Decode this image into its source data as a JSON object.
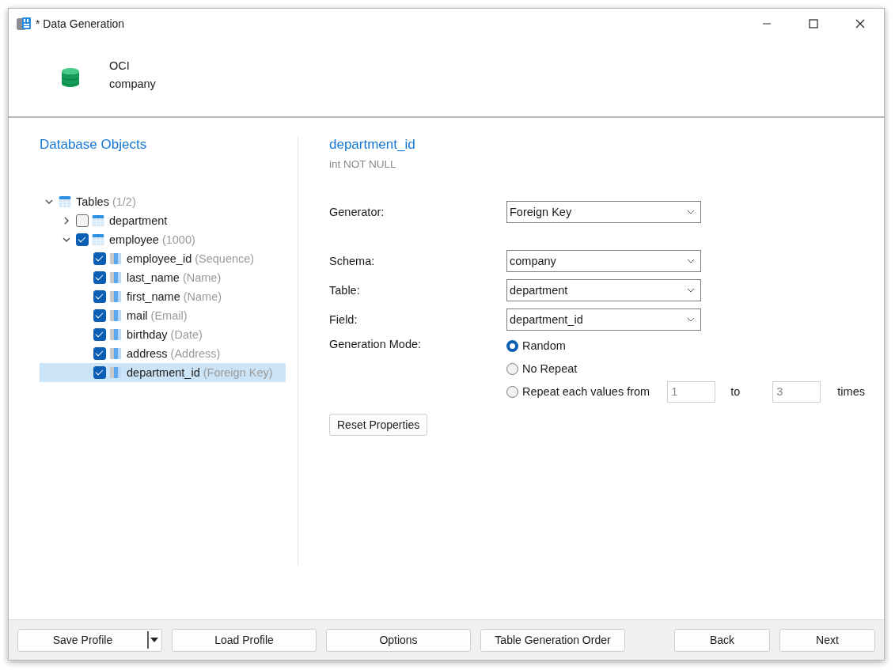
{
  "window": {
    "title": "* Data Generation"
  },
  "connection": {
    "type": "OCI",
    "database": "company"
  },
  "tree": {
    "title": "Database Objects",
    "nodes": [
      {
        "kind": "group",
        "label": "Tables",
        "count": "(1/2)",
        "expanded": true,
        "children": [
          {
            "kind": "table",
            "label": "department",
            "checked": false,
            "expanded": false,
            "selected": false
          },
          {
            "kind": "table",
            "label": "employee",
            "count": "(1000)",
            "checked": true,
            "expanded": true,
            "selected": false,
            "children": [
              {
                "kind": "column",
                "label": "employee_id",
                "hint": "(Sequence)",
                "checked": true,
                "selected": false
              },
              {
                "kind": "column",
                "label": "last_name",
                "hint": "(Name)",
                "checked": true,
                "selected": false
              },
              {
                "kind": "column",
                "label": "first_name",
                "hint": "(Name)",
                "checked": true,
                "selected": false
              },
              {
                "kind": "column",
                "label": "mail",
                "hint": "(Email)",
                "checked": true,
                "selected": false
              },
              {
                "kind": "column",
                "label": "birthday",
                "hint": "(Date)",
                "checked": true,
                "selected": false
              },
              {
                "kind": "column",
                "label": "address",
                "hint": "(Address)",
                "checked": true,
                "selected": false
              },
              {
                "kind": "column",
                "label": "department_id",
                "hint": "(Foreign Key)",
                "checked": true,
                "selected": true
              }
            ]
          }
        ]
      }
    ]
  },
  "field": {
    "name": "department_id",
    "type": "int NOT NULL"
  },
  "generator": {
    "label": "Generator:",
    "value": "Foreign Key"
  },
  "fields": [
    {
      "label": "Schema:",
      "value": "company"
    },
    {
      "label": "Table:",
      "value": "department"
    },
    {
      "label": "Field:",
      "value": "department_id"
    }
  ],
  "mode": {
    "label": "Generation Mode:",
    "options": [
      {
        "label": "Random",
        "selected": true
      },
      {
        "label": "No Repeat",
        "selected": false
      },
      {
        "label": "Repeat each values from",
        "selected": false,
        "from": "1",
        "to_label": "to",
        "to": "3",
        "suffix": "times"
      }
    ]
  },
  "reset_button": "Reset Properties",
  "footer": {
    "left": [
      {
        "kind": "split",
        "label": "Save Profile"
      },
      {
        "kind": "plain",
        "label": "Load Profile"
      },
      {
        "kind": "plain",
        "label": "Options"
      },
      {
        "kind": "plain",
        "label": "Table Generation Order"
      }
    ],
    "right": [
      {
        "kind": "plain",
        "label": "Back"
      },
      {
        "kind": "plain",
        "label": "Next"
      }
    ]
  }
}
